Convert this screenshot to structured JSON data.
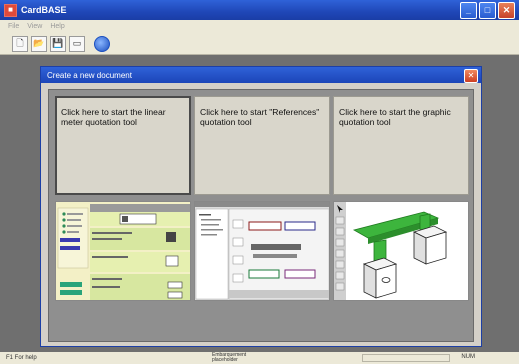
{
  "window": {
    "title": "CardBASE",
    "min": "_",
    "max": "□",
    "close": "✕"
  },
  "menu": [
    "File",
    "View",
    "Help"
  ],
  "toolbar": {
    "icons": [
      "new-document-icon",
      "open-folder-icon",
      "save-icon",
      "print-icon",
      "help-globe-icon"
    ]
  },
  "dialog": {
    "title": "Create a new document",
    "close": "✕",
    "options": [
      {
        "label": "Click here to start the linear meter quotation tool"
      },
      {
        "label": "Click here to start \"References\" quotation tool"
      },
      {
        "label": "Click here to start the graphic quotation tool"
      }
    ]
  },
  "status": {
    "left": "F1 For help",
    "center": "Embarquement\nplaceholder",
    "right": "NUM"
  }
}
